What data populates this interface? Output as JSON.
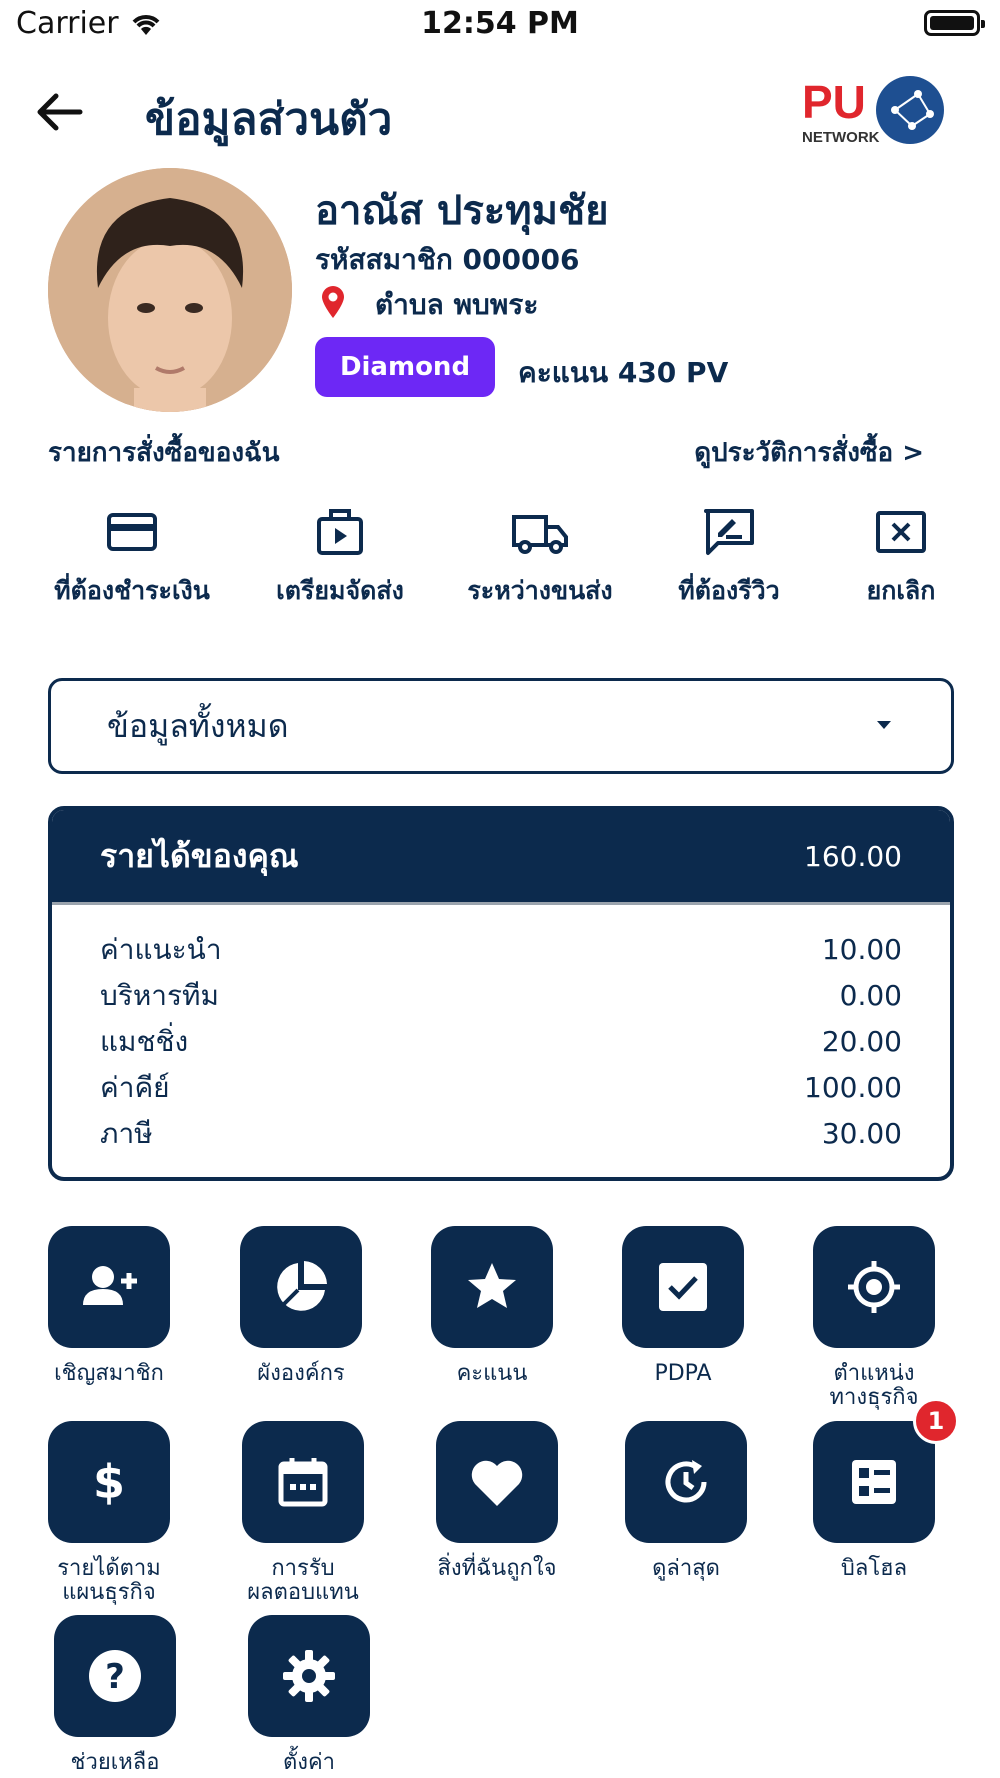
{
  "status_bar": {
    "carrier": "Carrier",
    "time": "12:54 PM"
  },
  "header": {
    "title": "ข้อมูลส่วนตัว",
    "logo_text": "PU",
    "logo_sub": "NETWORK"
  },
  "profile": {
    "name": "อาณัส ประทุมชัย",
    "member_id": "รหัสสมาชิก 000006",
    "location": "ตำบล พบพระ",
    "rank": "Diamond",
    "points": "คะแนน 430 PV",
    "rank_color": "#6d28f5"
  },
  "orders": {
    "label": "รายการสั่งซื้อของฉัน",
    "history_link": "ดูประวัติการสั่งซื้อ >",
    "items": [
      {
        "label": "ที่ต้องชำระเงิน",
        "icon": "credit-card-icon"
      },
      {
        "label": "เตรียมจัดส่ง",
        "icon": "package-icon"
      },
      {
        "label": "ระหว่างขนส่ง",
        "icon": "truck-icon"
      },
      {
        "label": "ที่ต้องรีวิว",
        "icon": "review-icon"
      },
      {
        "label": "ยกเลิก",
        "icon": "cancel-icon"
      }
    ]
  },
  "filter": {
    "selected": "ข้อมูลทั้งหมด"
  },
  "income": {
    "title": "รายได้ของคุณ",
    "total": "160.00",
    "rows": [
      {
        "label": "ค่าแนะนำ",
        "value": "10.00"
      },
      {
        "label": "บริหารทีม",
        "value": "0.00"
      },
      {
        "label": "แมชชิ่ง",
        "value": "20.00"
      },
      {
        "label": "ค่าคีย์",
        "value": "100.00"
      },
      {
        "label": "ภาษี",
        "value": "30.00"
      }
    ]
  },
  "menu": {
    "row1": [
      {
        "label": "เชิญสมาชิก",
        "icon": "add-user-icon"
      },
      {
        "label": "ผังองค์กร",
        "icon": "pie-chart-icon"
      },
      {
        "label": "คะแนน",
        "icon": "star-icon"
      },
      {
        "label": "PDPA",
        "icon": "checkbox-icon"
      },
      {
        "label": "ตำแหน่ง\nทางธุรกิจ",
        "icon": "target-icon"
      }
    ],
    "row2": [
      {
        "label": "รายได้ตาม\nแผนธุรกิจ",
        "icon": "dollar-icon"
      },
      {
        "label": "การรับ\nผลตอบแทน",
        "icon": "calendar-icon"
      },
      {
        "label": "สิ่งที่ฉันถูกใจ",
        "icon": "heart-icon"
      },
      {
        "label": "ดูล่าสุด",
        "icon": "history-icon"
      },
      {
        "label": "บิลโฮล",
        "icon": "bill-icon",
        "badge": "1"
      }
    ],
    "row3": [
      {
        "label": "ช่วยเหลือ",
        "icon": "help-icon"
      },
      {
        "label": "ตั้งค่า",
        "icon": "settings-icon"
      }
    ]
  },
  "colors": {
    "primary": "#0c2a4d",
    "badge": "#e0262d",
    "pin": "#e0262d"
  }
}
